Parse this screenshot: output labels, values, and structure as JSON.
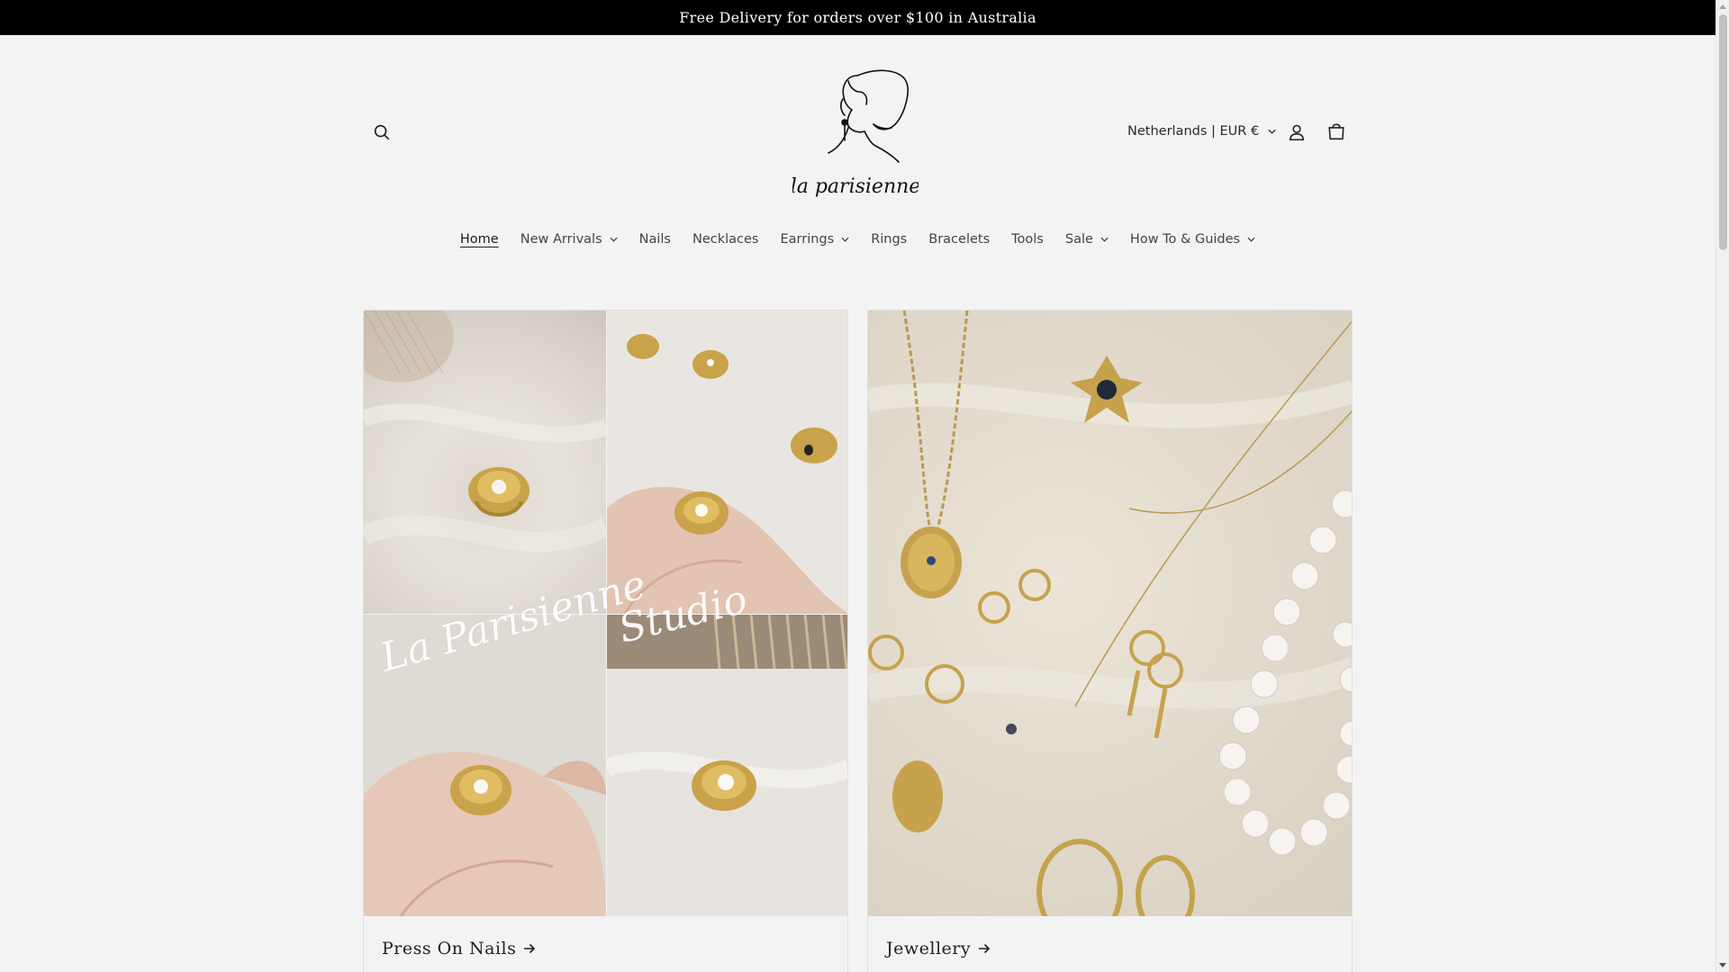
{
  "announcement": "Free Delivery for orders over $100 in Australia",
  "header": {
    "logo_text": "la parisienne",
    "country_selector": "Netherlands | EUR €"
  },
  "nav": {
    "items": [
      {
        "label": "Home",
        "dropdown": false,
        "active": true
      },
      {
        "label": "New Arrivals",
        "dropdown": true
      },
      {
        "label": "Nails",
        "dropdown": false
      },
      {
        "label": "Necklaces",
        "dropdown": false
      },
      {
        "label": "Earrings",
        "dropdown": true
      },
      {
        "label": "Rings",
        "dropdown": false
      },
      {
        "label": "Bracelets",
        "dropdown": false
      },
      {
        "label": "Tools",
        "dropdown": false
      },
      {
        "label": "Sale",
        "dropdown": true
      },
      {
        "label": "How To & Guides",
        "dropdown": true
      }
    ]
  },
  "collections": [
    {
      "title": "Press On Nails",
      "overlay_text_1": "La Parisienne",
      "overlay_text_2": "Studio"
    },
    {
      "title": "Jewellery"
    }
  ],
  "icons": {
    "search": "search-icon",
    "account": "account-icon",
    "cart": "cart-icon",
    "arrow": "arrow-right-icon",
    "chevron": "chevron-down-icon"
  }
}
